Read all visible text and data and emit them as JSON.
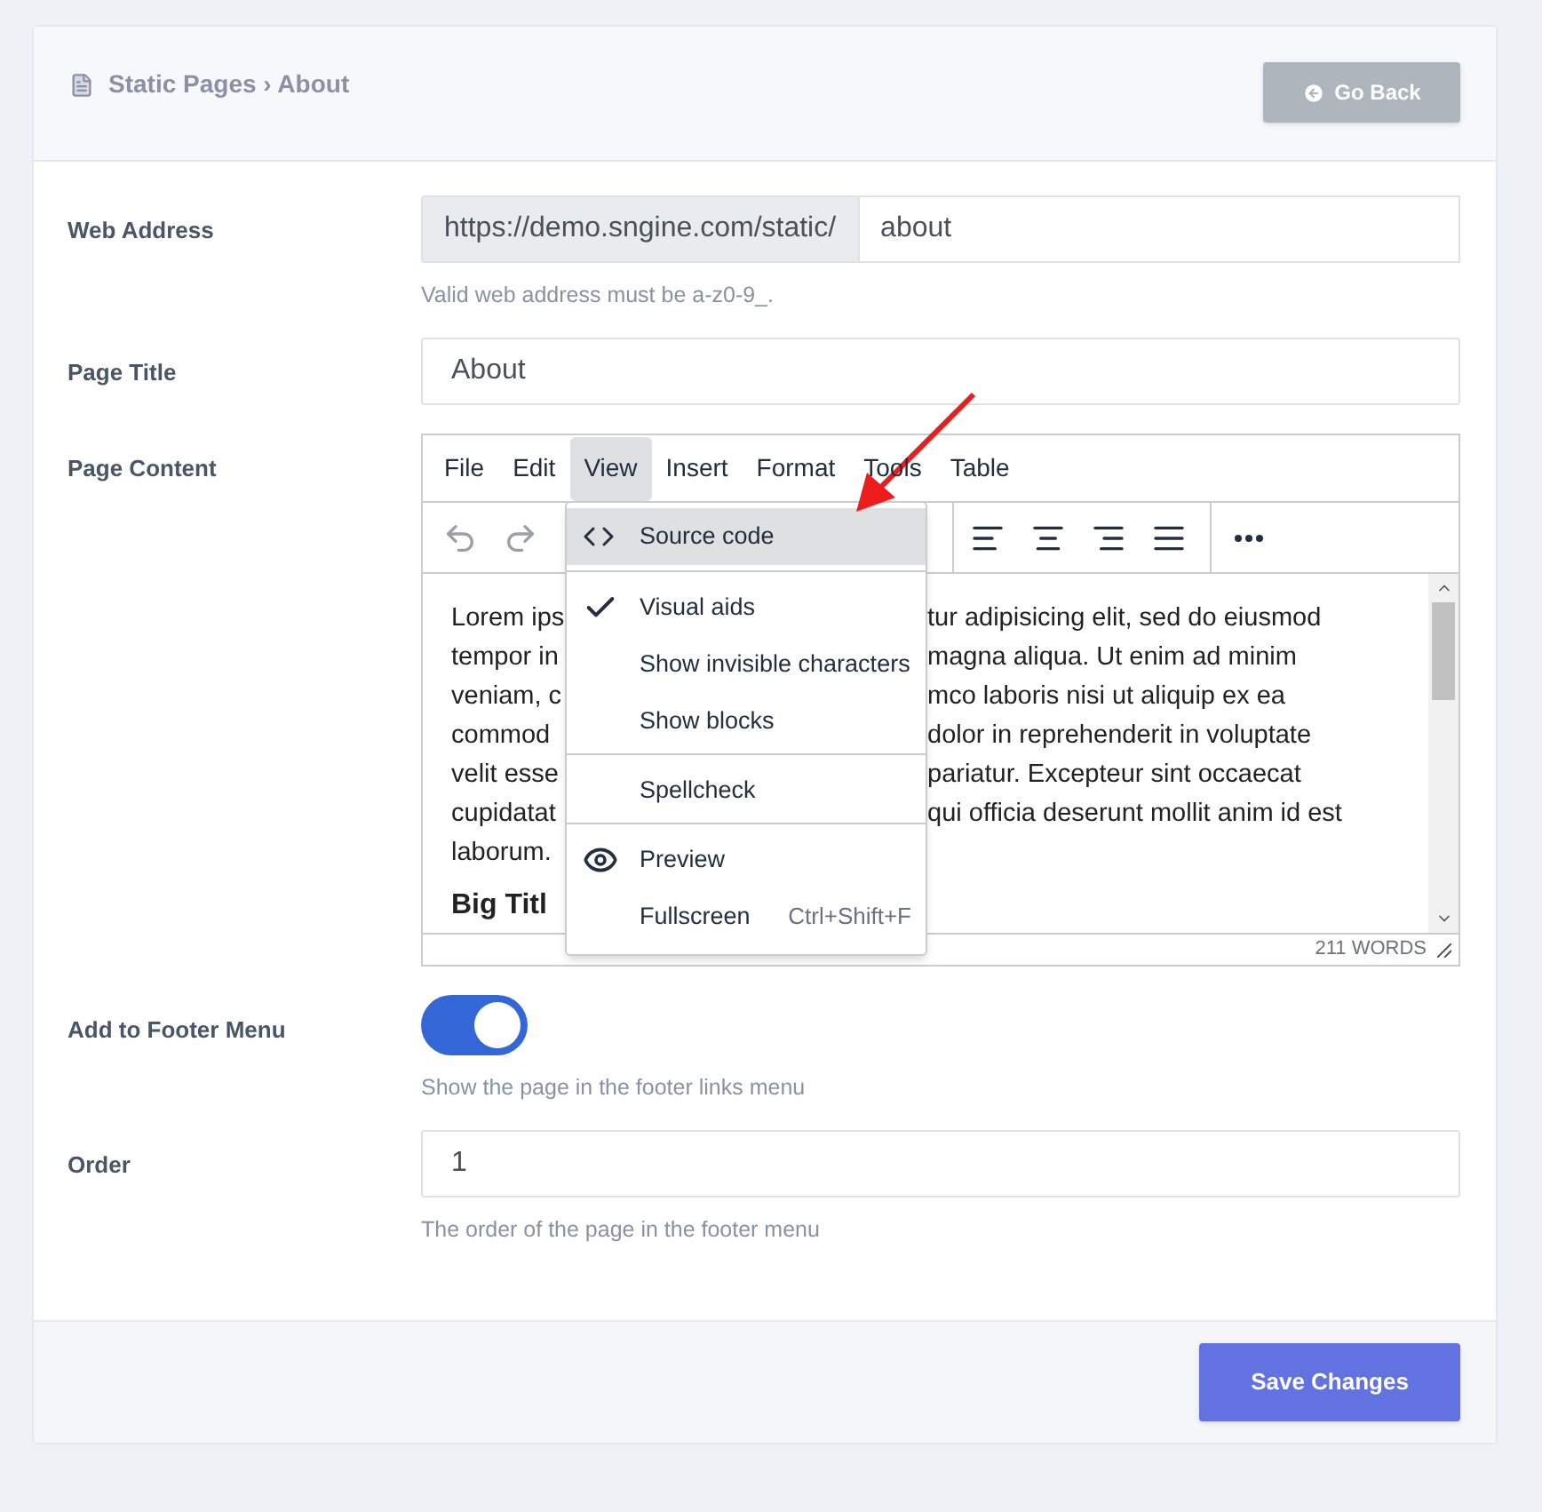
{
  "header": {
    "breadcrumb": "Static Pages › About",
    "back_button": "Go Back"
  },
  "fields": [
    {
      "kind": "address",
      "label": "Web Address",
      "prefix": "https://demo.sngine.com/static/",
      "value": "about",
      "hint": "Valid web address must be a-z0-9_."
    },
    {
      "kind": "text",
      "label": "Page Title",
      "value": "About"
    },
    {
      "kind": "editor",
      "label": "Page Content"
    },
    {
      "kind": "toggle",
      "label": "Add to Footer Menu",
      "on": true,
      "hint": "Show the page in the footer links menu"
    },
    {
      "kind": "text",
      "label": "Order",
      "value": "1",
      "hint": "The order of the page in the footer menu"
    }
  ],
  "editor": {
    "menubar": [
      {
        "label": "File",
        "selected": false
      },
      {
        "label": "Edit",
        "selected": false
      },
      {
        "label": "View",
        "selected": true
      },
      {
        "label": "Insert",
        "selected": false
      },
      {
        "label": "Format",
        "selected": false
      },
      {
        "label": "Tools",
        "selected": false
      },
      {
        "label": "Table",
        "selected": false
      }
    ],
    "content": {
      "lines": [
        {
          "left": "Lorem ips",
          "right": "tur adipisicing elit, sed do eiusmod"
        },
        {
          "left": "tempor in",
          "right": "magna aliqua. Ut enim ad minim"
        },
        {
          "left": "veniam, c",
          "right": "mco laboris nisi ut aliquip ex ea"
        },
        {
          "left": "commod",
          "right": "dolor in reprehenderit in voluptate"
        },
        {
          "left": "velit esse",
          "right": "pariatur. Excepteur sint occaecat"
        },
        {
          "left": "cupidatat",
          "right": "qui officia deserunt mollit anim id est"
        },
        {
          "left": "laborum."
        }
      ],
      "heading": "Big Titl"
    },
    "word_count": "211 WORDS",
    "menu": {
      "groups": [
        [
          {
            "kind": "code",
            "label": "Source code",
            "highlighted": true
          }
        ],
        [
          {
            "kind": "toggle",
            "label": "Visual aids",
            "checked": true,
            "highlighted": false
          },
          {
            "kind": "toggle",
            "label": "Show invisible characters",
            "checked": false,
            "highlighted": false
          },
          {
            "kind": "toggle",
            "label": "Show blocks",
            "checked": false,
            "highlighted": false
          }
        ],
        [
          {
            "kind": "toggle",
            "label": "Spellcheck",
            "checked": false,
            "highlighted": false
          }
        ],
        [
          {
            "kind": "preview",
            "label": "Preview",
            "highlighted": false
          },
          {
            "kind": "toggle",
            "label": "Fullscreen",
            "checked": false,
            "shortcut": "Ctrl+Shift+F",
            "highlighted": false
          }
        ]
      ]
    }
  },
  "footer": {
    "save_button": "Save Changes"
  }
}
